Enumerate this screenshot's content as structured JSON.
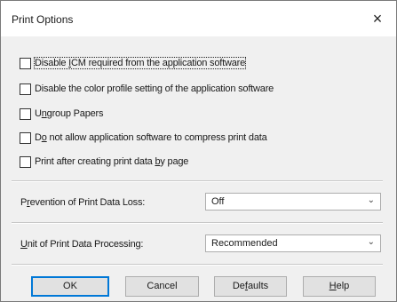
{
  "dialog": {
    "title": "Print Options",
    "close_glyph": "×"
  },
  "options": [
    {
      "label_pre": "Disable ",
      "label_key": "I",
      "label_post": "CM required from the application software",
      "checked": false
    },
    {
      "label_pre": "Disable the color profile setting of the application software",
      "label_key": "",
      "label_post": "",
      "checked": false
    },
    {
      "label_pre": "U",
      "label_key": "n",
      "label_post": "group Papers",
      "checked": false
    },
    {
      "label_pre": "D",
      "label_key": "o",
      "label_post": " not allow application software to compress print data",
      "checked": false
    },
    {
      "label_pre": "Print after creating print data ",
      "label_key": "b",
      "label_post": "y page",
      "checked": false
    }
  ],
  "fields": {
    "prevention": {
      "label_pre": "P",
      "label_key": "r",
      "label_post": "evention of Print Data Loss:",
      "value": "Off"
    },
    "unit": {
      "label_pre": "",
      "label_key": "U",
      "label_post": "nit of Print Data Processing:",
      "value": "Recommended"
    }
  },
  "buttons": {
    "ok": "OK",
    "cancel": "Cancel",
    "defaults_pre": "De",
    "defaults_key": "f",
    "defaults_post": "aults",
    "help_pre": "",
    "help_key": "H",
    "help_post": "elp"
  },
  "icons": {
    "close": "close-icon",
    "dropdown": "chevron-down-icon"
  }
}
